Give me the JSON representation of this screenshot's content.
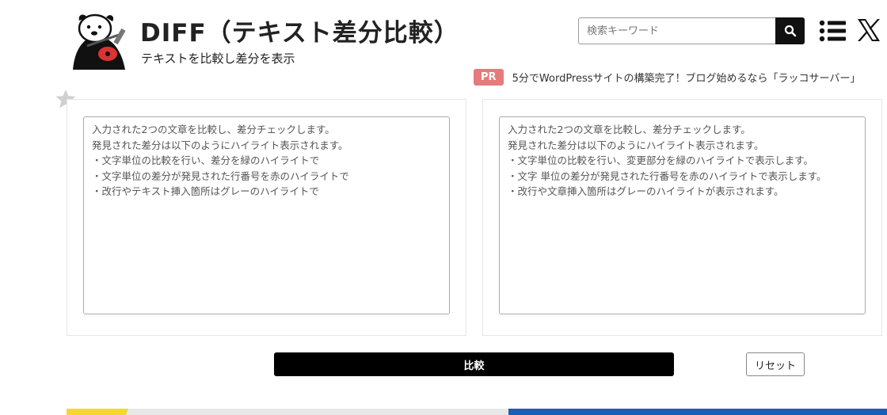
{
  "header": {
    "title": "DIFF（テキスト差分比較）",
    "subtitle": "テキストを比較し差分を表示"
  },
  "search": {
    "placeholder": "検索キーワード",
    "button_icon": "search-icon"
  },
  "icons": {
    "menu": "list-menu-icon",
    "social": "x-icon",
    "favorite": "star-icon",
    "logo": "otter-guitar-logo"
  },
  "pr": {
    "badge": "PR",
    "text": "5分でWordPressサイトの構築完了！ブログ始めるなら「ラッコサーバー」"
  },
  "editor": {
    "left_text": "入力された2つの文章を比較し、差分チェックします。\n発見された差分は以下のようにハイライト表示されます。\n・文字単位の比較を行い、差分を緑のハイライトで\n・文字単位の差分が発見された行番号を赤のハイライトで\n・改行やテキスト挿入箇所はグレーのハイライトで",
    "right_text": "入力された2つの文章を比較し、差分チェックします。\n発見された差分は以下のようにハイライト表示されます。\n・文字単位の比較を行い、変更部分を緑のハイライトで表示します。\n・文字 単位の差分が発見された行番号を赤のハイライトで表示します。\n・改行や文章挿入箇所はグレーのハイライトが表示されます。"
  },
  "actions": {
    "compare_label": "比較",
    "reset_label": "リセット"
  },
  "colors": {
    "pr_badge": "#e57b7b",
    "primary_button": "#000000",
    "bar_yellow": "#f4d92b",
    "bar_blue": "#1b5fb3"
  }
}
